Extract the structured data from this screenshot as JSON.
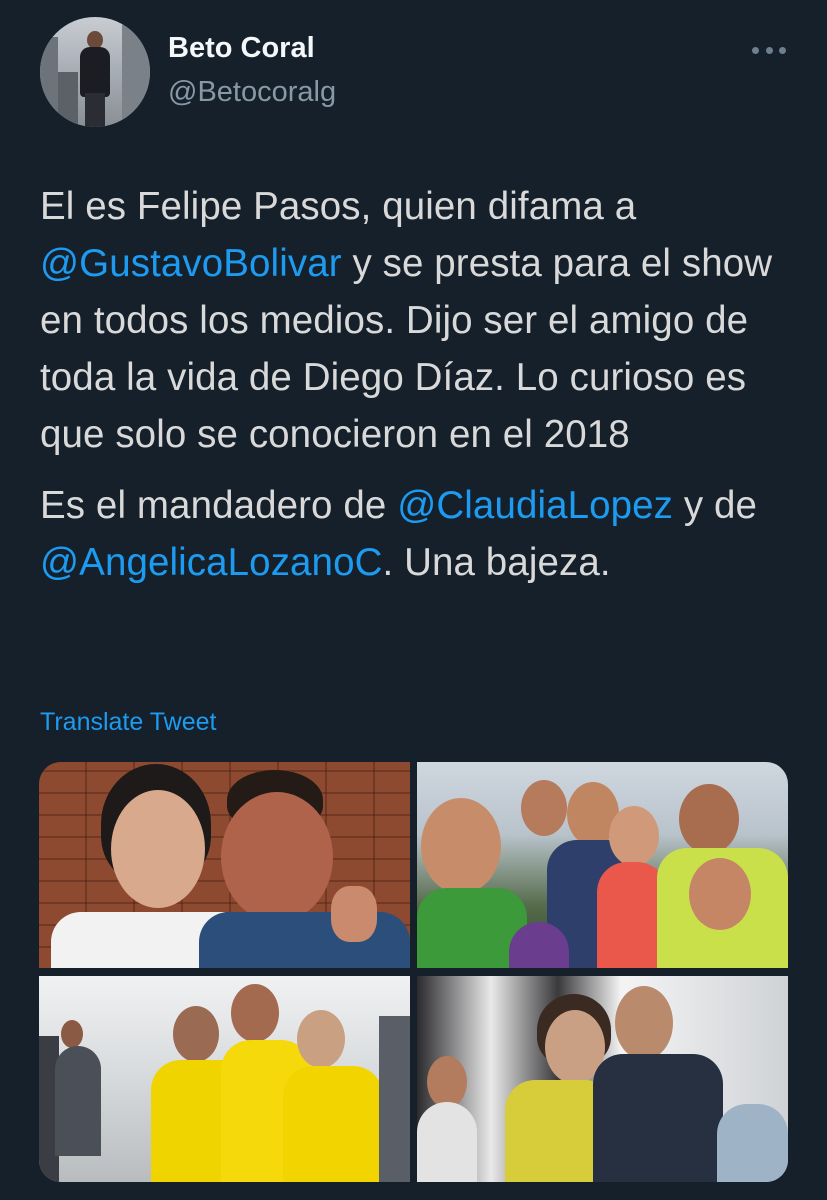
{
  "user": {
    "name": "Beto Coral",
    "handle": "@Betocoralg"
  },
  "tweet": {
    "paragraph1": {
      "text1": "El es Felipe Pasos, quien difama a ",
      "mention1": "@GustavoBolivar",
      "text2": " y se presta para el show en todos los medios.  Dijo ser el amigo de toda la vida de Diego Díaz. Lo curioso es que solo se conocieron en el 2018"
    },
    "paragraph2": {
      "text1": "Es el mandadero de ",
      "mention1": "@ClaudiaLopez",
      "text2": " y de ",
      "mention2": "@AngelicaLozanoC",
      "text3": ". Una bajeza."
    }
  },
  "translate_label": "Translate Tweet",
  "colors": {
    "background": "#15202b",
    "text": "#d9d9d9",
    "link": "#1d9bf0",
    "secondary": "#8899a6"
  }
}
